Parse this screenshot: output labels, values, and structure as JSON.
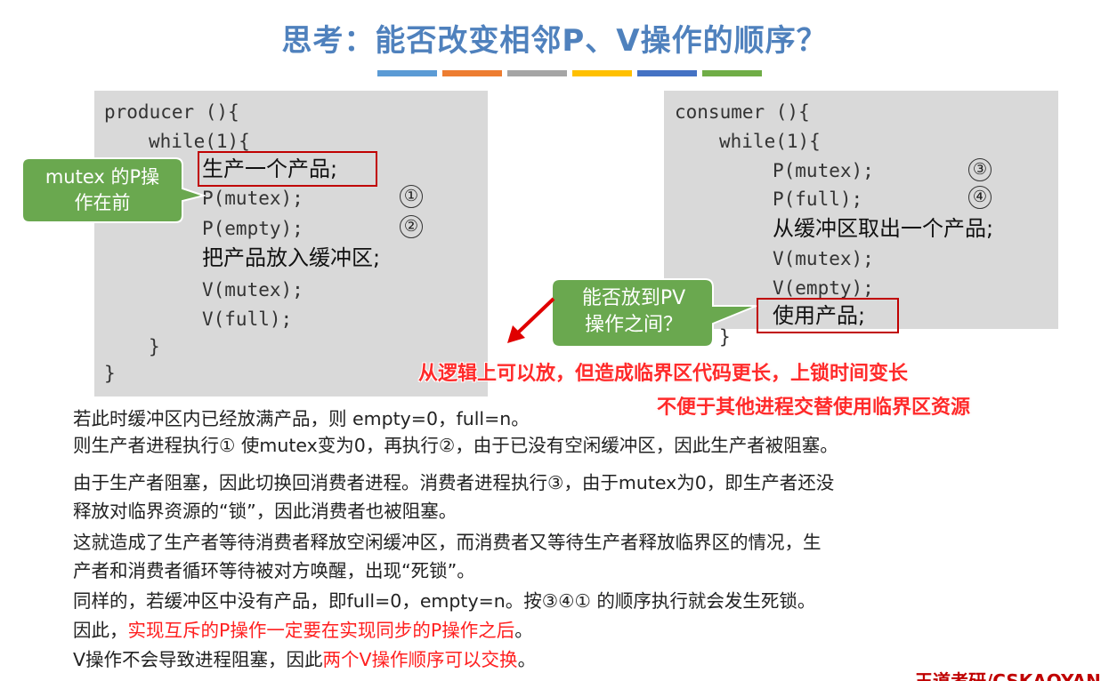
{
  "title": "思考：能否改变相邻P、V操作的顺序？",
  "colorbar": [
    "#5b9bd5",
    "#ed7d31",
    "#a5a5a5",
    "#ffc000",
    "#4472c4",
    "#70ad47"
  ],
  "producer": {
    "header": "producer (){",
    "while": "while(1){",
    "make": "生产一个产品;",
    "p_mutex": "P(mutex);",
    "p_empty": "P(empty);",
    "put": "把产品放入缓冲区;",
    "v_mutex": "V(mutex);",
    "v_full": "V(full);",
    "close_inner": "}",
    "close_outer": "}",
    "mark1": "①",
    "mark2": "②"
  },
  "consumer": {
    "header": "consumer (){",
    "while": "while(1){",
    "p_mutex": "P(mutex);",
    "p_full": "P(full);",
    "take": "从缓冲区取出一个产品;",
    "v_mutex": "V(mutex);",
    "v_empty": "V(empty);",
    "use": "使用产品;",
    "close_inner": "}",
    "mark3": "③",
    "mark4": "④"
  },
  "callouts": {
    "mutex_first_line1": "mutex 的P操",
    "mutex_first_line2": "作在前",
    "pv_question_line1": "能否放到PV",
    "pv_question_line2": "操作之间？",
    "green": "#6aa84f"
  },
  "red_notes": {
    "line1": "从逻辑上可以放，但造成临界区代码更长，上锁时间变长",
    "line2": "不便于其他进程交替使用临界区资源"
  },
  "explanation": {
    "l1": "若此时缓冲区内已经放满产品，则 empty=0，full=n。",
    "l2": "则生产者进程执行① 使mutex变为0，再执行②，由于已没有空闲缓冲区，因此生产者被阻塞。",
    "l3": "由于生产者阻塞，因此切换回消费者进程。消费者进程执行③，由于mutex为0，即生产者还没",
    "l4": "释放对临界资源的“锁”，因此消费者也被阻塞。",
    "l5": "这就造成了生产者等待消费者释放空闲缓冲区，而消费者又等待生产者释放临界区的情况，生",
    "l6": "产者和消费者循环等待被对方唤醒，出现“死锁”。",
    "l7": "同样的，若缓冲区中没有产品，即full=0，empty=n。按③④① 的顺序执行就会发生死锁。",
    "l8_prefix": "因此，",
    "l8_red": "实现互斥的P操作一定要在实现同步的P操作之后",
    "l8_suffix": "。",
    "l9_prefix": "V操作不会导致进程阻塞，因此",
    "l9_red": "两个V操作顺序可以交换",
    "l9_suffix": "。"
  },
  "footer": "王道考研/CSKAOYAN"
}
